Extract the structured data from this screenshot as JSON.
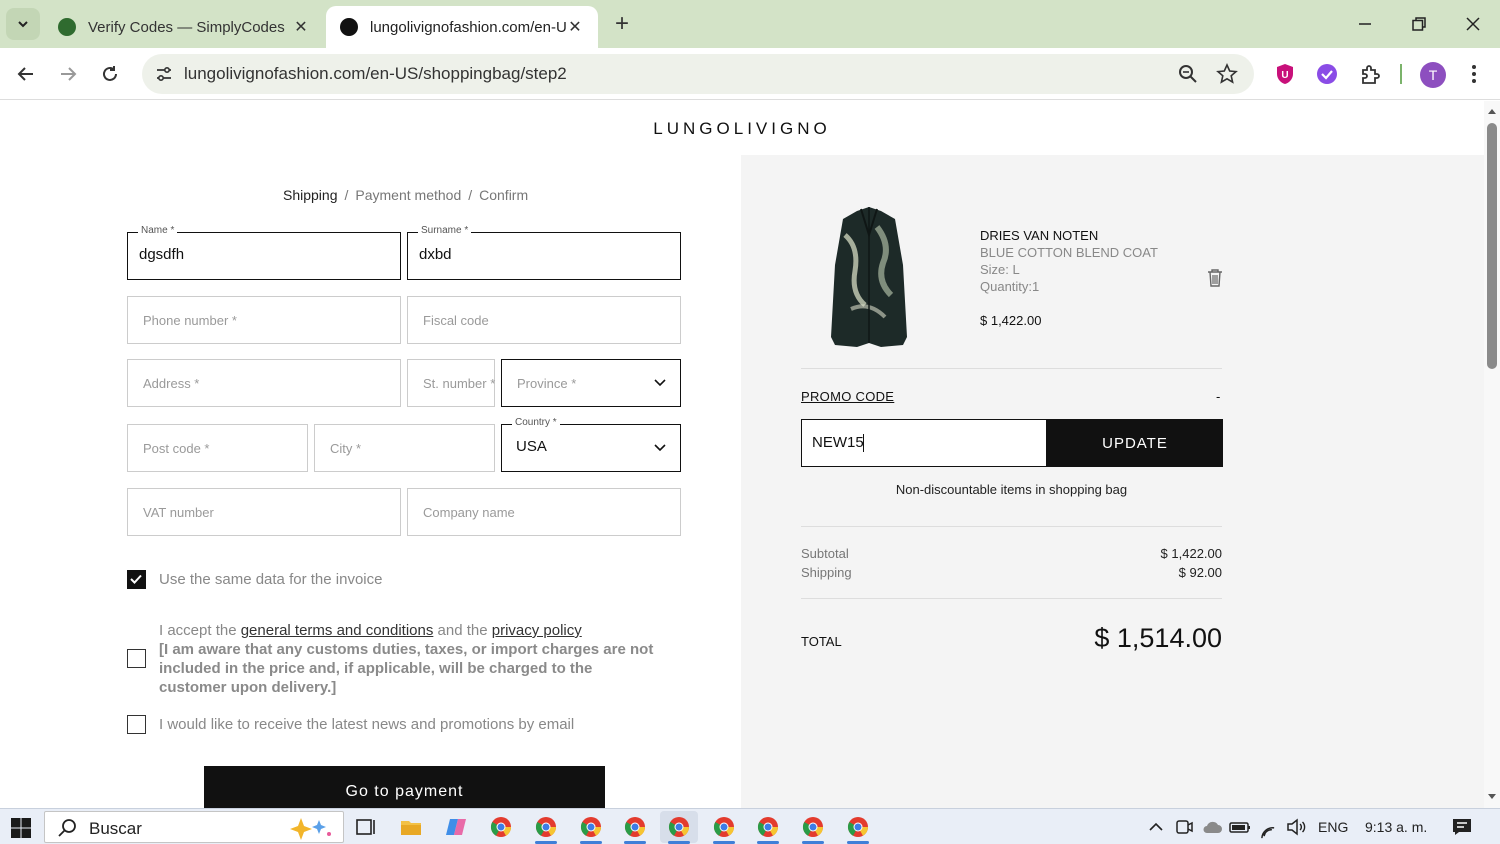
{
  "browser": {
    "tabs": [
      {
        "title": "Verify Codes — SimplyCodes",
        "active": false
      },
      {
        "title": "lungolivignofashion.com/en-US",
        "active": true
      }
    ],
    "url": "lungolivignofashion.com/en-US/shoppingbag/step2",
    "profile_initial": "T"
  },
  "site": {
    "logo": "LUNGOLIVIGNO"
  },
  "breadcrumb": {
    "steps": [
      "Shipping",
      "Payment method",
      "Confirm"
    ],
    "separator": "/"
  },
  "form": {
    "name": {
      "label": "Name *",
      "value": "dgsdfh"
    },
    "surname": {
      "label": "Surname *",
      "value": "dxbd"
    },
    "phone": {
      "placeholder": "Phone number *"
    },
    "fiscal": {
      "placeholder": "Fiscal code"
    },
    "address": {
      "placeholder": "Address *"
    },
    "st_number": {
      "placeholder": "St. number *"
    },
    "province": {
      "placeholder": "Province *"
    },
    "post_code": {
      "placeholder": "Post code *"
    },
    "city": {
      "placeholder": "City *"
    },
    "country": {
      "label": "Country *",
      "value": "USA"
    },
    "vat": {
      "placeholder": "VAT number"
    },
    "company": {
      "placeholder": "Company name"
    },
    "same_invoice": {
      "label": "Use the same data for the invoice",
      "checked": true
    },
    "terms": {
      "prefix": "I accept the ",
      "terms_link": "general terms and conditions",
      "middle": " and the ",
      "privacy_link": "privacy policy",
      "notice": "[I am aware that any customs duties, taxes, or import charges are not included in the price and, if applicable, will be charged to the customer upon delivery.]",
      "checked": false
    },
    "newsletter": {
      "label": "I would like to receive the latest news and promotions by email",
      "checked": false
    },
    "pay_button": "Go to payment"
  },
  "cart": {
    "item": {
      "brand": "DRIES VAN NOTEN",
      "name": "BLUE COTTON BLEND COAT",
      "size": "Size: L",
      "quantity": "Quantity:1",
      "price": "$ 1,422.00"
    },
    "promo": {
      "label": "PROMO CODE",
      "toggle": "-",
      "value": "NEW15",
      "button": "UPDATE",
      "message": "Non-discountable items in shopping bag"
    },
    "summary": {
      "subtotal_label": "Subtotal",
      "subtotal": "$ 1,422.00",
      "shipping_label": "Shipping",
      "shipping": "$ 92.00",
      "total_label": "TOTAL",
      "total": "$ 1,514.00"
    }
  },
  "taskbar": {
    "search_placeholder": "Buscar",
    "language": "ENG",
    "time": "9:13 a. m."
  }
}
